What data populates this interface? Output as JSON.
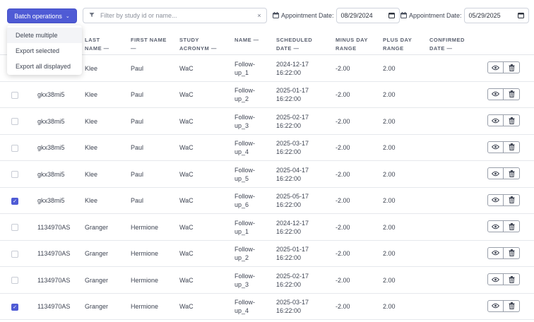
{
  "toolbar": {
    "batch_label": "Batch operations",
    "filter_placeholder": "Filter by study id or name...",
    "filter_clear": "×",
    "appt_label_1": "Appointment Date:",
    "appt_value_1": "08/29/2024",
    "appt_label_2": "Appointment Date:",
    "appt_value_2": "05/29/2025"
  },
  "dropdown": {
    "items": [
      "Delete multiple",
      "Export selected",
      "Export all displayed"
    ]
  },
  "columns": {
    "last_name_1": "LAST",
    "last_name_2": "NAME —",
    "first_name_1": "FIRST NAME",
    "first_name_2": "—",
    "acronym_1": "STUDY",
    "acronym_2": "ACRONYM —",
    "name": "NAME —",
    "scheduled_1": "SCHEDULED",
    "scheduled_2": "DATE —",
    "minus_1": "MINUS DAY",
    "minus_2": "RANGE",
    "plus_1": "PLUS DAY",
    "plus_2": "RANGE",
    "confirmed_1": "CONFIRMED",
    "confirmed_2": "DATE —"
  },
  "icons": {
    "view": "eye-icon",
    "delete": "trash-icon",
    "calendar": "calendar-icon",
    "filter": "filter-icon",
    "chevron": "chevron-down-icon"
  },
  "colors": {
    "accent": "#4f5bd5"
  },
  "rows": [
    {
      "checked": false,
      "study_id": "",
      "last": "Klee",
      "first": "Paul",
      "acronym": "WaC",
      "name1": "Follow-",
      "name2": "up_1",
      "date1": "2024-12-17",
      "date2": "16:22:00",
      "minus": "-2.00",
      "plus": "2.00"
    },
    {
      "checked": false,
      "study_id": "gkx38mi5",
      "last": "Klee",
      "first": "Paul",
      "acronym": "WaC",
      "name1": "Follow-",
      "name2": "up_2",
      "date1": "2025-01-17",
      "date2": "16:22:00",
      "minus": "-2.00",
      "plus": "2.00"
    },
    {
      "checked": false,
      "study_id": "gkx38mi5",
      "last": "Klee",
      "first": "Paul",
      "acronym": "WaC",
      "name1": "Follow-",
      "name2": "up_3",
      "date1": "2025-02-17",
      "date2": "16:22:00",
      "minus": "-2.00",
      "plus": "2.00"
    },
    {
      "checked": false,
      "study_id": "gkx38mi5",
      "last": "Klee",
      "first": "Paul",
      "acronym": "WaC",
      "name1": "Follow-",
      "name2": "up_4",
      "date1": "2025-03-17",
      "date2": "16:22:00",
      "minus": "-2.00",
      "plus": "2.00"
    },
    {
      "checked": false,
      "study_id": "gkx38mi5",
      "last": "Klee",
      "first": "Paul",
      "acronym": "WaC",
      "name1": "Follow-",
      "name2": "up_5",
      "date1": "2025-04-17",
      "date2": "16:22:00",
      "minus": "-2.00",
      "plus": "2.00"
    },
    {
      "checked": true,
      "study_id": "gkx38mi5",
      "last": "Klee",
      "first": "Paul",
      "acronym": "WaC",
      "name1": "Follow-",
      "name2": "up_6",
      "date1": "2025-05-17",
      "date2": "16:22:00",
      "minus": "-2.00",
      "plus": "2.00"
    },
    {
      "checked": false,
      "study_id": "1134970AS",
      "last": "Granger",
      "first": "Hermione",
      "acronym": "WaC",
      "name1": "Follow-",
      "name2": "up_1",
      "date1": "2024-12-17",
      "date2": "16:22:00",
      "minus": "-2.00",
      "plus": "2.00"
    },
    {
      "checked": false,
      "study_id": "1134970AS",
      "last": "Granger",
      "first": "Hermione",
      "acronym": "WaC",
      "name1": "Follow-",
      "name2": "up_2",
      "date1": "2025-01-17",
      "date2": "16:22:00",
      "minus": "-2.00",
      "plus": "2.00"
    },
    {
      "checked": false,
      "study_id": "1134970AS",
      "last": "Granger",
      "first": "Hermione",
      "acronym": "WaC",
      "name1": "Follow-",
      "name2": "up_3",
      "date1": "2025-02-17",
      "date2": "16:22:00",
      "minus": "-2.00",
      "plus": "2.00"
    },
    {
      "checked": true,
      "study_id": "1134970AS",
      "last": "Granger",
      "first": "Hermione",
      "acronym": "WaC",
      "name1": "Follow-",
      "name2": "up_4",
      "date1": "2025-03-17",
      "date2": "16:22:00",
      "minus": "-2.00",
      "plus": "2.00"
    }
  ]
}
